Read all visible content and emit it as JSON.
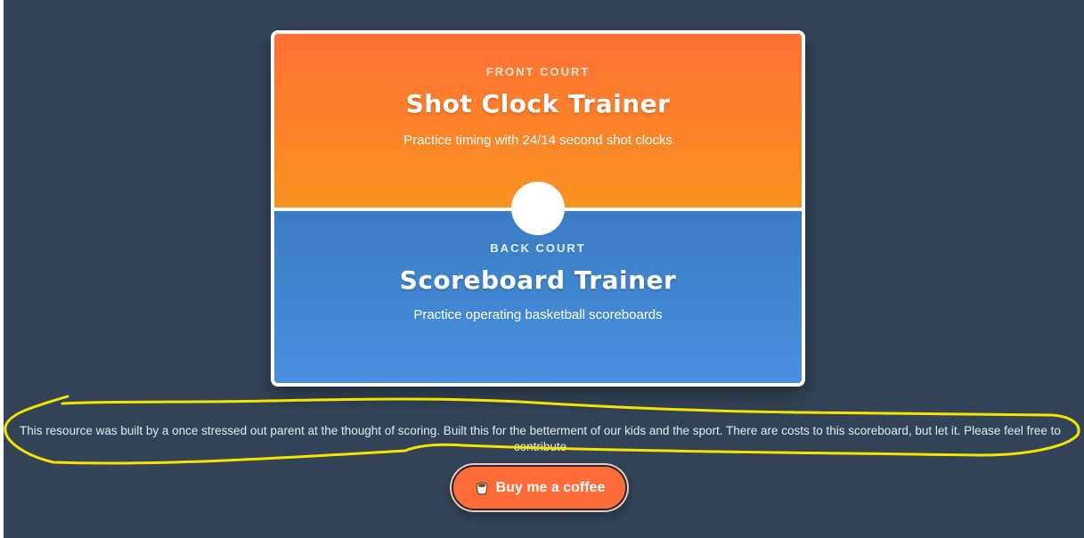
{
  "front_court": {
    "eyebrow": "FRONT COURT",
    "title": "Shot Clock Trainer",
    "subtitle": "Practice timing with 24/14 second shot clocks"
  },
  "back_court": {
    "eyebrow": "BACK COURT",
    "title": "Scoreboard Trainer",
    "subtitle": "Practice operating basketball scoreboards"
  },
  "footer_note": "This resource was built by a once stressed out parent at the thought of scoring. Built this for the betterment of our kids and the sport. There are costs to this scoreboard, but let it. Please feel free to contribute",
  "coffee_button": {
    "label": "Buy me a coffee",
    "icon": "coffee-cup-icon"
  },
  "colors": {
    "background": "#334459",
    "front_court": "#ff7035",
    "back_court": "#4a90e0",
    "button": "#ff6c37",
    "highlight": "#f5e400"
  }
}
